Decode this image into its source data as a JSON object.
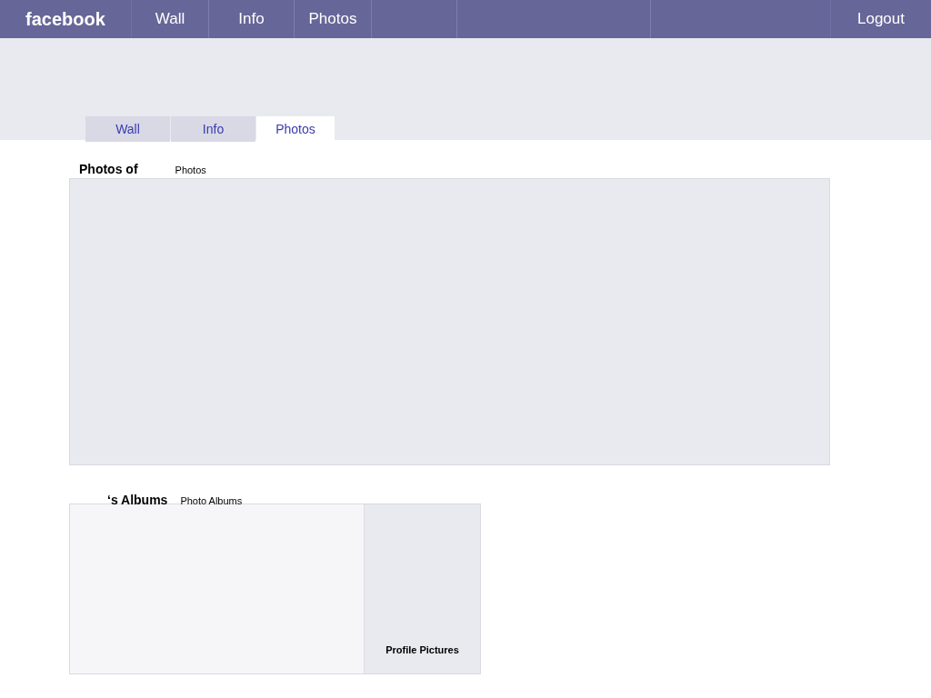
{
  "nav": {
    "logo": "facebook",
    "items": [
      {
        "label": "Wall"
      },
      {
        "label": "Info"
      },
      {
        "label": "Photos"
      }
    ],
    "logout": "Logout"
  },
  "tabs": [
    {
      "label": "Wall",
      "selected": false
    },
    {
      "label": "Info",
      "selected": false
    },
    {
      "label": "Photos",
      "selected": true
    }
  ],
  "photos_section": {
    "title": "Photos of",
    "subtitle": "Photos"
  },
  "albums_section": {
    "title": "‘s Albums",
    "subtitle": "Photo Albums",
    "albums": [
      {
        "title": "Profile Pictures"
      }
    ]
  }
}
